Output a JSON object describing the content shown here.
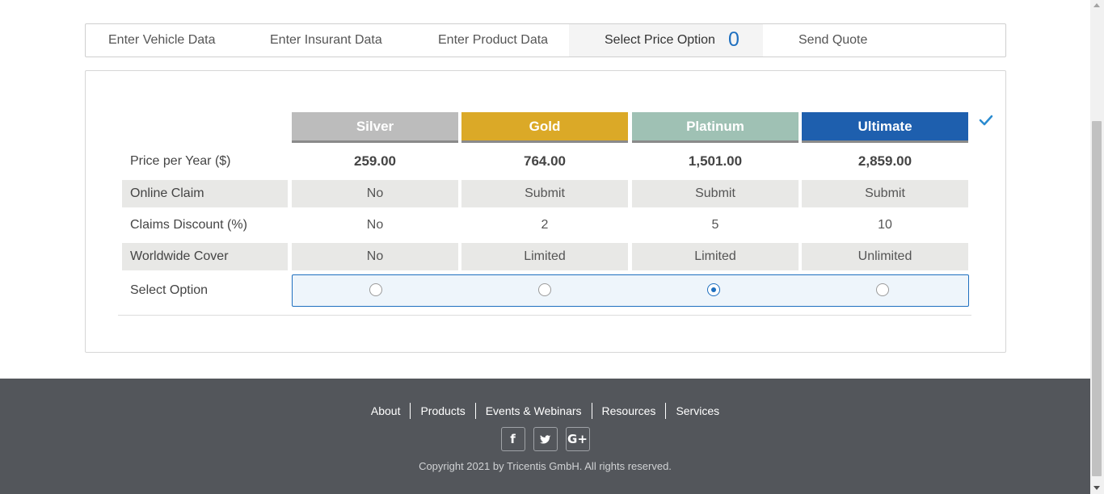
{
  "wizard": {
    "tabs": [
      {
        "label": "Enter Vehicle Data"
      },
      {
        "label": "Enter Insurant Data"
      },
      {
        "label": "Enter Product Data"
      },
      {
        "label": "Select Price Option",
        "counter": "0",
        "active": true
      },
      {
        "label": "Send Quote"
      }
    ]
  },
  "plans": [
    {
      "name": "Silver",
      "color": "#bcbcbc"
    },
    {
      "name": "Gold",
      "color": "#dba927"
    },
    {
      "name": "Platinum",
      "color": "#9fc1b4"
    },
    {
      "name": "Ultimate",
      "color": "#1e5fae"
    }
  ],
  "rows": [
    {
      "label": "Price per Year ($)",
      "values": [
        "259.00",
        "764.00",
        "1,501.00",
        "2,859.00"
      ]
    },
    {
      "label": "Online Claim",
      "values": [
        "No",
        "Submit",
        "Submit",
        "Submit"
      ]
    },
    {
      "label": "Claims Discount (%)",
      "values": [
        "No",
        "2",
        "5",
        "10"
      ]
    },
    {
      "label": "Worldwide Cover",
      "values": [
        "No",
        "Limited",
        "Limited",
        "Unlimited"
      ]
    }
  ],
  "select_option": {
    "label": "Select Option",
    "selected": "Platinum"
  },
  "footer": {
    "links": [
      "About",
      "Products",
      "Events & Webinars",
      "Resources",
      "Services"
    ],
    "social": [
      {
        "icon": "facebook-icon",
        "glyph": "f"
      },
      {
        "icon": "twitter-icon",
        "glyph": "🐦"
      },
      {
        "icon": "google-plus-icon",
        "glyph": "G+"
      }
    ],
    "copyright": "Copyright 2021 by Tricentis GmbH. All rights reserved."
  },
  "colors": {
    "accent": "#1e6fbf",
    "footer_bg": "#53565b"
  }
}
